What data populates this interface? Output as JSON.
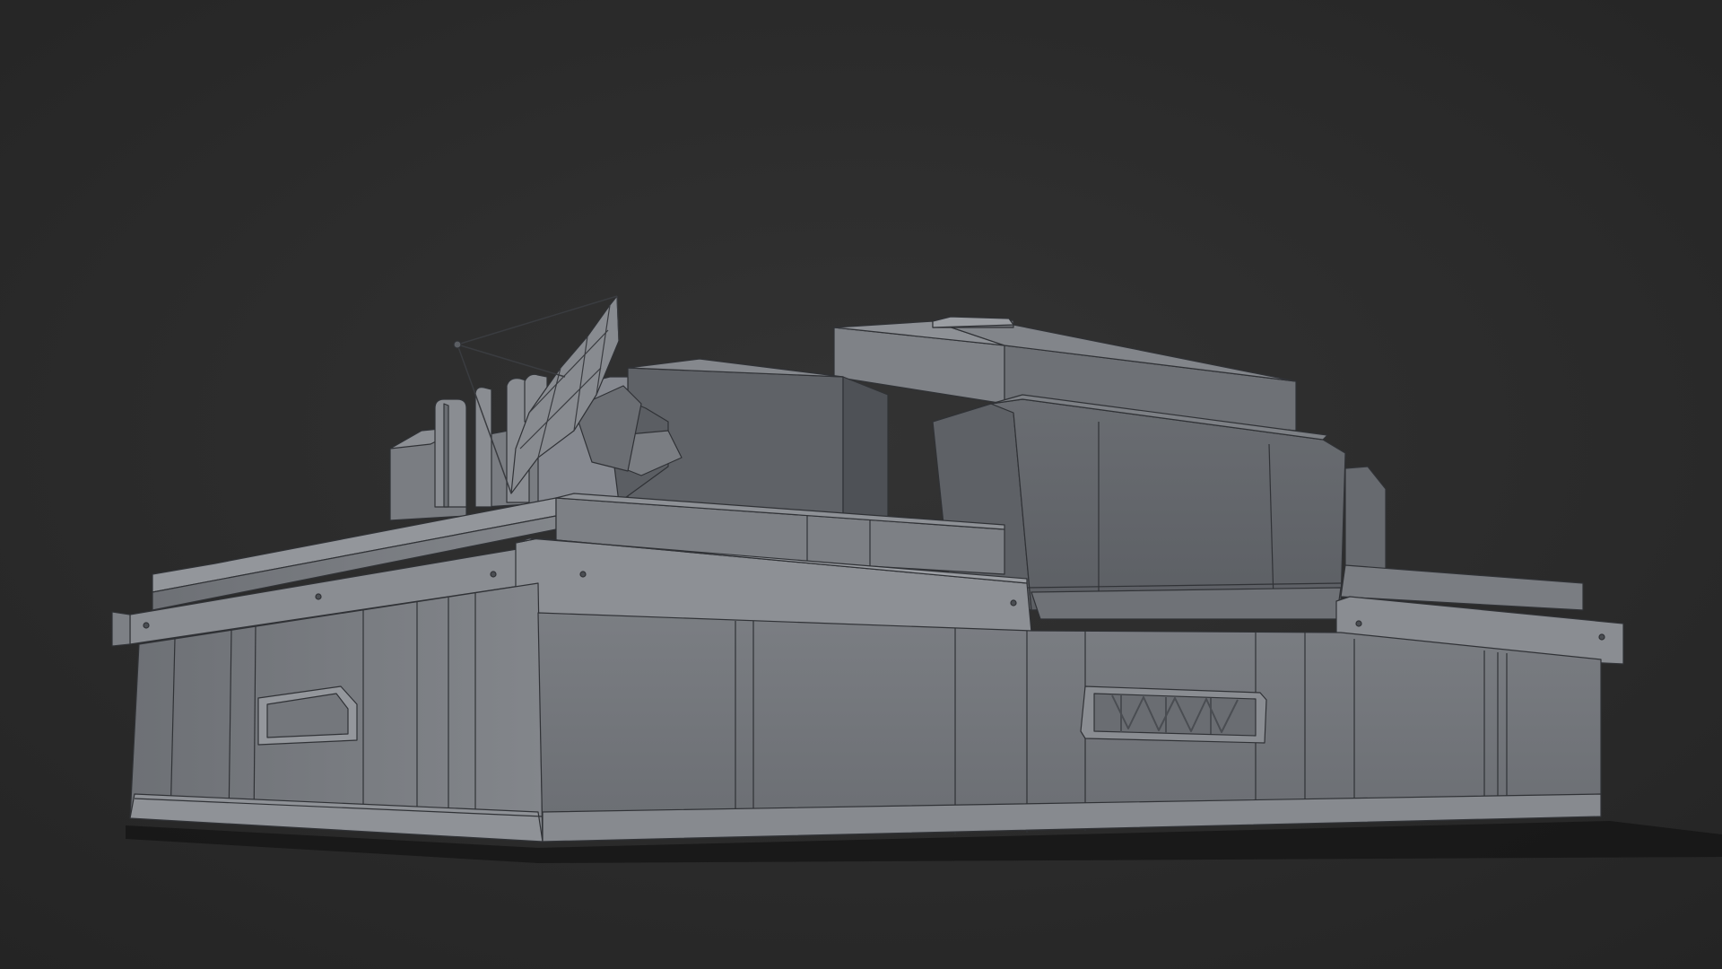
{
  "scene": {
    "background_color": "#2b2b2b",
    "ground_shadow_color": "#141414",
    "model_light_color": "#8c8e92",
    "model_mid_color": "#72757a",
    "model_dark_color": "#55585d",
    "wire_color": "#303236"
  },
  "model": {
    "parts": [
      "ground-shadow",
      "base-block",
      "left-ledge",
      "center-ledge",
      "right-ledge",
      "roof-box",
      "front-panel",
      "vent-pipes",
      "satellite-dish",
      "left-plate",
      "right-grille"
    ]
  }
}
